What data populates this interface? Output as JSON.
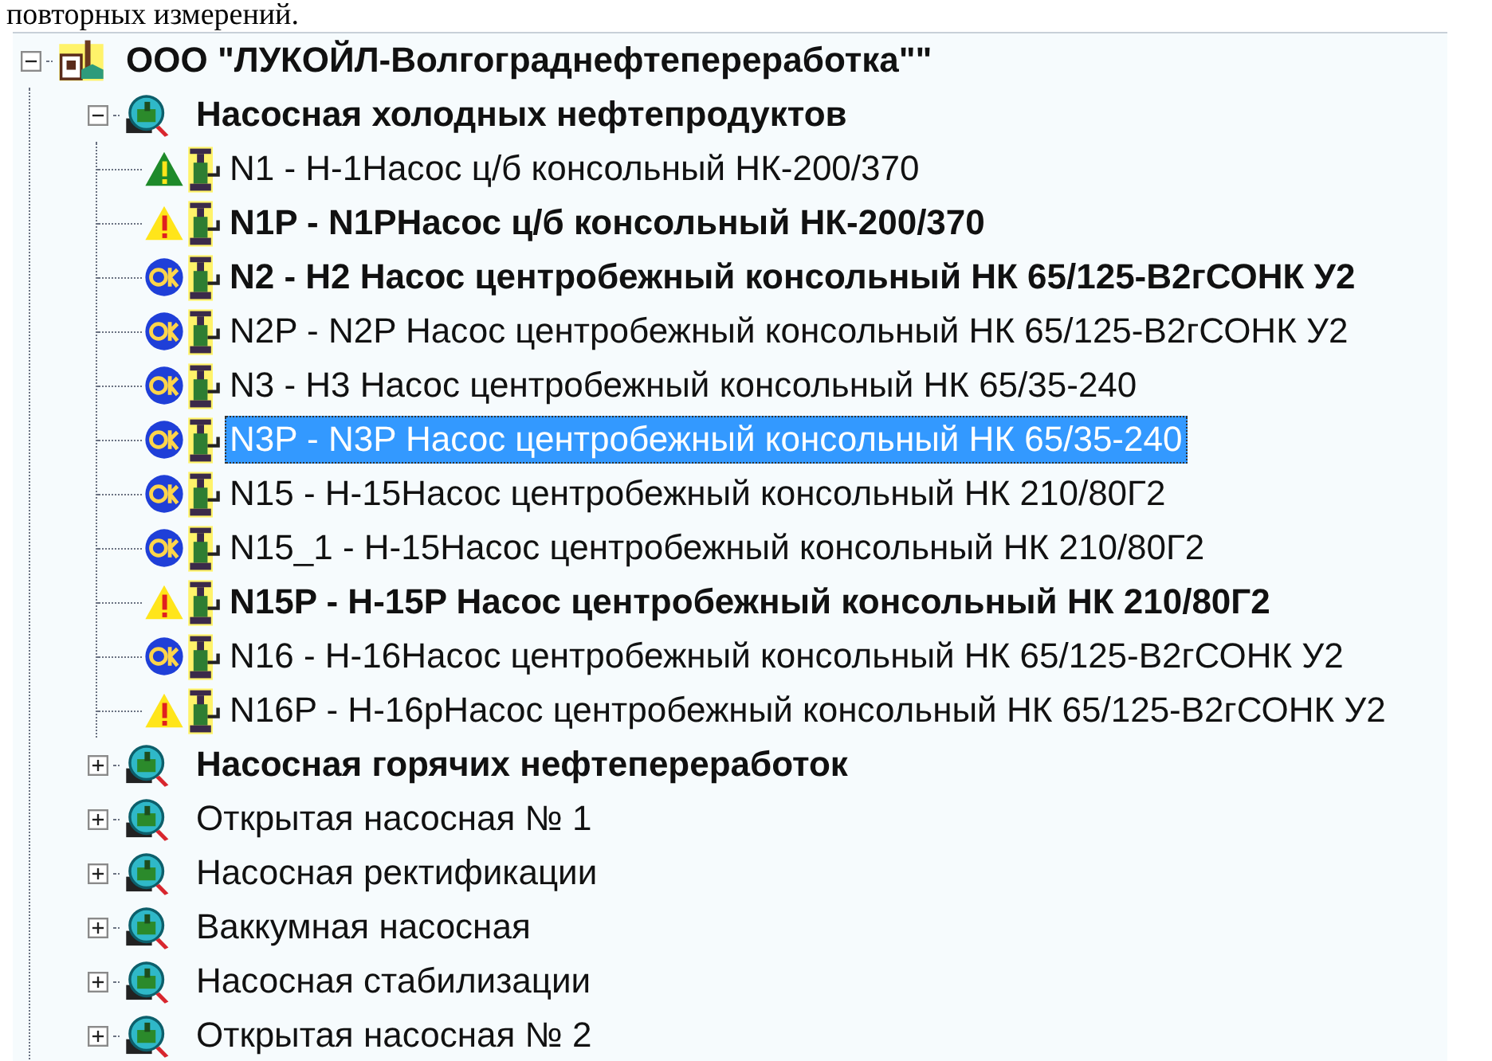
{
  "caption_fragment": "повторных измерений.",
  "tree": {
    "label": "ООО \"ЛУКОЙЛ-Волгограднефтепереработка\"\"",
    "bold": true,
    "expanded": true,
    "children": [
      {
        "label": "Насосная холодных нефтепродуктов",
        "bold": true,
        "expanded": true,
        "children": [
          {
            "label": "N1 - Н-1Насос ц/б консольный НК-200/370",
            "bold": false,
            "kind": "green-alert",
            "selected": false
          },
          {
            "label": "N1P - N1PНасос ц/б консольный НК-200/370",
            "bold": true,
            "kind": "yellow-alert",
            "selected": false
          },
          {
            "label": "N2 - Н2 Насос центробежный консольный НК 65/125-В2гСОНК У2",
            "bold": true,
            "kind": "ok",
            "selected": false
          },
          {
            "label": "N2P - N2P Насос центробежный консольный НК 65/125-В2гСОНК У2",
            "bold": false,
            "kind": "ok",
            "selected": false
          },
          {
            "label": "N3 - Н3 Насос центробежный консольный НК 65/35-240",
            "bold": false,
            "kind": "ok",
            "selected": false
          },
          {
            "label": "N3P - N3P Насос центробежный консольный НК 65/35-240",
            "bold": false,
            "kind": "ok",
            "selected": true
          },
          {
            "label": "N15 - Н-15Насос центробежный консольный НК 210/80Г2",
            "bold": false,
            "kind": "ok",
            "selected": false
          },
          {
            "label": "N15_1 - Н-15Насос центробежный консольный НК 210/80Г2",
            "bold": false,
            "kind": "ok",
            "selected": false
          },
          {
            "label": "N15P - Н-15P Насос центробежный консольный НК 210/80Г2",
            "bold": true,
            "kind": "yellow-alert",
            "selected": false
          },
          {
            "label": "N16 - Н-16Насос центробежный консольный НК 65/125-В2гСОНК У2",
            "bold": false,
            "kind": "ok",
            "selected": false
          },
          {
            "label": "N16P - Н-16рНасос центробежный консольный НК 65/125-В2гСОНК У2",
            "bold": false,
            "kind": "yellow-alert",
            "selected": false
          }
        ]
      },
      {
        "label": "Насосная горячих нефтепереработок",
        "bold": true,
        "expanded": false
      },
      {
        "label": "Открытая насосная № 1",
        "bold": false,
        "expanded": false
      },
      {
        "label": "Насосная ректификации",
        "bold": false,
        "expanded": false
      },
      {
        "label": "Ваккумная насосная",
        "bold": false,
        "expanded": false
      },
      {
        "label": "Насосная стабилизации",
        "bold": false,
        "expanded": false
      },
      {
        "label": "Открытая насосная № 2",
        "bold": false,
        "expanded": false
      }
    ]
  }
}
